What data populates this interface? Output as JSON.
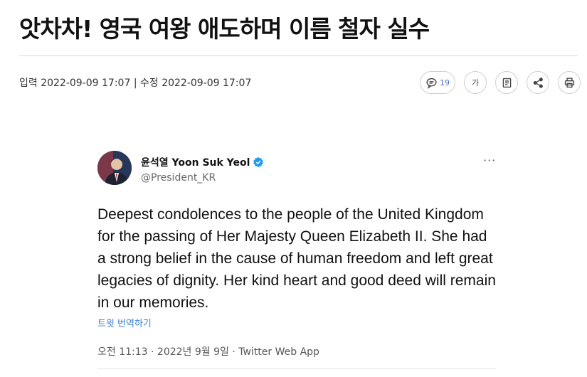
{
  "article": {
    "headline": "앗차차! 영국 여왕 애도하며 이름 철자 실수",
    "meta": "입력 2022-09-09 17:07 | 수정 2022-09-09 17:07"
  },
  "toolbar": {
    "comment_count": "19",
    "font_size_label": "가",
    "icons": [
      "comment-icon",
      "font-size-icon",
      "bookmark-icon",
      "share-icon",
      "print-icon"
    ]
  },
  "tweet": {
    "display_name": "윤석열 Yoon Suk Yeol",
    "handle": "@President_KR",
    "more_label": "···",
    "text": "Deepest condolences to the people of the United Kingdom for the passing of Her Majesty Queen Elizabeth II. She had a strong belief in the cause of human freedom and left great legacies of dignity. Her kind heart and good deed will remain in our memories.",
    "translate_label": "트윗 번역하기",
    "timestamp": "오전 11:13 · 2022년 9월 9일 · Twitter Web App",
    "colors": {
      "verified": "#1d9bf0",
      "translate_link": "#3b82d6"
    }
  }
}
